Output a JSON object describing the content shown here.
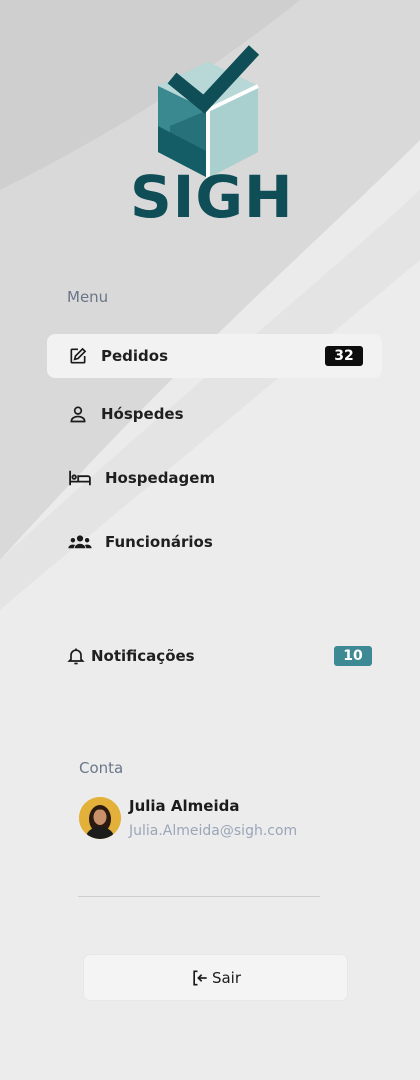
{
  "brand": {
    "name": "SIGH",
    "primary_color": "#0f4d57",
    "accent_color": "#3d8a94"
  },
  "menu": {
    "label": "Menu",
    "items": [
      {
        "label": "Pedidos",
        "icon": "edit-icon",
        "badge": "32",
        "active": true
      },
      {
        "label": "Hóspedes",
        "icon": "user-icon"
      },
      {
        "label": "Hospedagem",
        "icon": "bed-icon"
      },
      {
        "label": "Funcionários",
        "icon": "group-icon"
      }
    ]
  },
  "notifications": {
    "label": "Notificações",
    "icon": "bell-icon",
    "badge": "10"
  },
  "account": {
    "label": "Conta",
    "name": "Julia Almeida",
    "email": "Julia.Almeida@sigh.com"
  },
  "logout": {
    "label": "Sair",
    "icon": "logout-icon"
  }
}
